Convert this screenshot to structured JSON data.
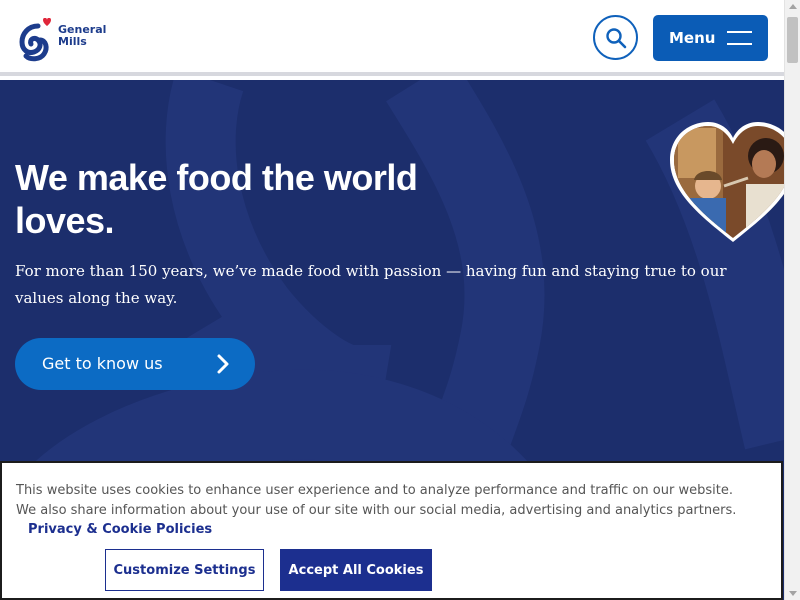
{
  "header": {
    "logo_line1": "General",
    "logo_line2": "Mills",
    "search_icon": "search-icon",
    "menu_label": "Menu",
    "menu_icon": "hamburger-icon"
  },
  "hero": {
    "title": "We make food the world loves.",
    "text": "For more than 150 years, we’ve made food with passion — having fun and staying true to our values along the way.",
    "cta_label": "Get to know us",
    "cta_icon": "chevron-right-icon",
    "image_icon": "heart-photo"
  },
  "cookie_banner": {
    "text": "This website uses cookies to enhance user experience and to analyze performance and traffic on our website. We also share information about your use of our site with our social media, advertising and analytics partners.",
    "policy_link": "Privacy & Cookie Policies",
    "customize_label": "Customize Settings",
    "accept_label": "Accept All Cookies"
  },
  "colors": {
    "brand_blue": "#1c2e6c",
    "button_blue": "#0b5cb6",
    "cookie_navy": "#1c2f8f",
    "heart_red": "#e0263a"
  }
}
